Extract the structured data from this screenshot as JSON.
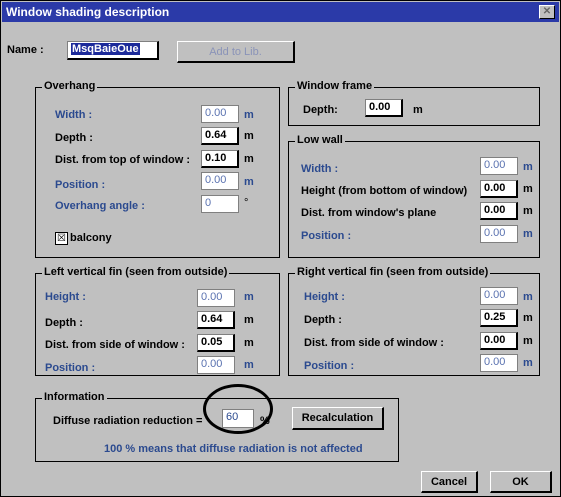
{
  "window": {
    "title": "Window shading description",
    "close": "✕"
  },
  "name": {
    "label": "Name :",
    "value": "MsqBaieOue",
    "add_button": "Add to Lib."
  },
  "overhang": {
    "title": "Overhang",
    "width_label": "Width :",
    "width": "0.00",
    "width_unit": "m",
    "depth_label": "Depth :",
    "depth": "0.64",
    "depth_unit": "m",
    "dist_label": "Dist. from top of window :",
    "dist": "0.10",
    "dist_unit": "m",
    "position_label": "Position :",
    "position": "0.00",
    "position_unit": "m",
    "angle_label": "Overhang angle :",
    "angle": "0",
    "angle_unit": "°",
    "balcony_label": "balcony",
    "balcony_checked": "☒"
  },
  "window_frame": {
    "title": "Window frame",
    "depth_label": "Depth:",
    "depth": "0.00",
    "depth_unit": "m"
  },
  "low_wall": {
    "title": "Low wall",
    "width_label": "Width :",
    "width": "0.00",
    "width_unit": "m",
    "height_label": "Height (from bottom of window)",
    "height": "0.00",
    "height_unit": "m",
    "dist_label": "Dist. from window's plane",
    "dist": "0.00",
    "dist_unit": "m",
    "position_label": "Position :",
    "position": "0.00",
    "position_unit": "m"
  },
  "left_fin": {
    "title": "Left vertical fin (seen from outside)",
    "height_label": "Height :",
    "height": "0.00",
    "height_unit": "m",
    "depth_label": "Depth :",
    "depth": "0.64",
    "depth_unit": "m",
    "dist_label": "Dist. from side of window :",
    "dist": "0.05",
    "dist_unit": "m",
    "position_label": "Position :",
    "position": "0.00",
    "position_unit": "m"
  },
  "right_fin": {
    "title": "Right vertical fin (seen from outside)",
    "height_label": "Height :",
    "height": "0.00",
    "height_unit": "m",
    "depth_label": "Depth :",
    "depth": "0.25",
    "depth_unit": "m",
    "dist_label": "Dist. from side of window :",
    "dist": "0.00",
    "dist_unit": "m",
    "position_label": "Position :",
    "position": "0.00",
    "position_unit": "m"
  },
  "information": {
    "title": "Information",
    "reduction_label": "Diffuse radiation reduction =",
    "reduction": "60",
    "reduction_unit": "%",
    "recalc_button": "Recalculation",
    "note": "100 % means that diffuse radiation is not affected"
  },
  "buttons": {
    "cancel": "Cancel",
    "ok": "OK"
  }
}
